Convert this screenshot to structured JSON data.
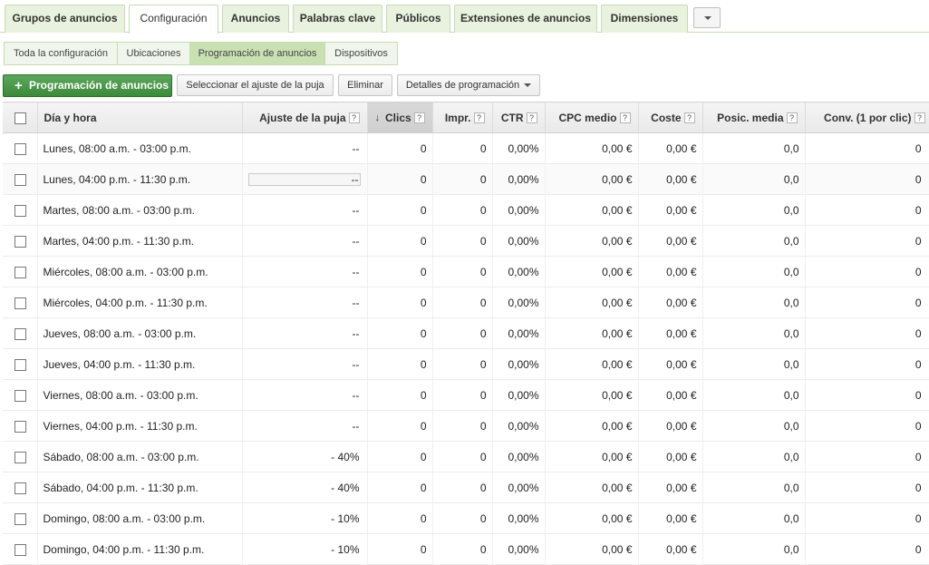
{
  "tabs": [
    {
      "label": "Grupos de anuncios"
    },
    {
      "label": "Configuración"
    },
    {
      "label": "Anuncios"
    },
    {
      "label": "Palabras clave"
    },
    {
      "label": "Públicos"
    },
    {
      "label": "Extensiones de anuncios"
    },
    {
      "label": "Dimensiones"
    }
  ],
  "subtabs": [
    {
      "label": "Toda la configuración"
    },
    {
      "label": "Ubicaciones"
    },
    {
      "label": "Programación de anuncios"
    },
    {
      "label": "Dispositivos"
    }
  ],
  "toolbar": {
    "add_label": "Programación de anuncios",
    "adjust_label": "Seleccionar el ajuste de la puja",
    "delete_label": "Eliminar",
    "details_label": "Detalles de programación"
  },
  "table": {
    "headers": {
      "day": "Día y hora",
      "bid": "Ajuste de la puja",
      "clicks": "Clics",
      "impr": "Impr.",
      "ctr": "CTR",
      "cpc": "CPC medio",
      "cost": "Coste",
      "pos": "Posic. media",
      "conv": "Conv. (1 por clic)"
    },
    "help_glyph": "?",
    "sort_glyph": "↓",
    "rows": [
      {
        "day": "Lunes, 08:00 a.m. - 03:00 p.m.",
        "bid": "--",
        "clicks": "0",
        "impr": "0",
        "ctr": "0,00%",
        "cpc": "0,00 €",
        "cost": "0,00 €",
        "pos": "0,0",
        "conv": "0"
      },
      {
        "day": "Lunes, 04:00 p.m. - 11:30 p.m.",
        "bid": "--",
        "clicks": "0",
        "impr": "0",
        "ctr": "0,00%",
        "cpc": "0,00 €",
        "cost": "0,00 €",
        "pos": "0,0",
        "conv": "0"
      },
      {
        "day": "Martes, 08:00 a.m. - 03:00 p.m.",
        "bid": "--",
        "clicks": "0",
        "impr": "0",
        "ctr": "0,00%",
        "cpc": "0,00 €",
        "cost": "0,00 €",
        "pos": "0,0",
        "conv": "0"
      },
      {
        "day": "Martes, 04:00 p.m. - 11:30 p.m.",
        "bid": "--",
        "clicks": "0",
        "impr": "0",
        "ctr": "0,00%",
        "cpc": "0,00 €",
        "cost": "0,00 €",
        "pos": "0,0",
        "conv": "0"
      },
      {
        "day": "Miércoles, 08:00 a.m. - 03:00 p.m.",
        "bid": "--",
        "clicks": "0",
        "impr": "0",
        "ctr": "0,00%",
        "cpc": "0,00 €",
        "cost": "0,00 €",
        "pos": "0,0",
        "conv": "0"
      },
      {
        "day": "Miércoles, 04:00 p.m. - 11:30 p.m.",
        "bid": "--",
        "clicks": "0",
        "impr": "0",
        "ctr": "0,00%",
        "cpc": "0,00 €",
        "cost": "0,00 €",
        "pos": "0,0",
        "conv": "0"
      },
      {
        "day": "Jueves, 08:00 a.m. - 03:00 p.m.",
        "bid": "--",
        "clicks": "0",
        "impr": "0",
        "ctr": "0,00%",
        "cpc": "0,00 €",
        "cost": "0,00 €",
        "pos": "0,0",
        "conv": "0"
      },
      {
        "day": "Jueves, 04:00 p.m. - 11:30 p.m.",
        "bid": "--",
        "clicks": "0",
        "impr": "0",
        "ctr": "0,00%",
        "cpc": "0,00 €",
        "cost": "0,00 €",
        "pos": "0,0",
        "conv": "0"
      },
      {
        "day": "Viernes, 08:00 a.m. - 03:00 p.m.",
        "bid": "--",
        "clicks": "0",
        "impr": "0",
        "ctr": "0,00%",
        "cpc": "0,00 €",
        "cost": "0,00 €",
        "pos": "0,0",
        "conv": "0"
      },
      {
        "day": "Viernes, 04:00 p.m. - 11:30 p.m.",
        "bid": "--",
        "clicks": "0",
        "impr": "0",
        "ctr": "0,00%",
        "cpc": "0,00 €",
        "cost": "0,00 €",
        "pos": "0,0",
        "conv": "0"
      },
      {
        "day": "Sábado, 08:00 a.m. - 03:00 p.m.",
        "bid": "- 40%",
        "clicks": "0",
        "impr": "0",
        "ctr": "0,00%",
        "cpc": "0,00 €",
        "cost": "0,00 €",
        "pos": "0,0",
        "conv": "0"
      },
      {
        "day": "Sábado, 04:00 p.m. - 11:30 p.m.",
        "bid": "- 40%",
        "clicks": "0",
        "impr": "0",
        "ctr": "0,00%",
        "cpc": "0,00 €",
        "cost": "0,00 €",
        "pos": "0,0",
        "conv": "0"
      },
      {
        "day": "Domingo, 08:00 a.m. - 03:00 p.m.",
        "bid": "- 10%",
        "clicks": "0",
        "impr": "0",
        "ctr": "0,00%",
        "cpc": "0,00 €",
        "cost": "0,00 €",
        "pos": "0,0",
        "conv": "0"
      },
      {
        "day": "Domingo, 04:00 p.m. - 11:30 p.m.",
        "bid": "- 10%",
        "clicks": "0",
        "impr": "0",
        "ctr": "0,00%",
        "cpc": "0,00 €",
        "cost": "0,00 €",
        "pos": "0,0",
        "conv": "0"
      }
    ]
  }
}
